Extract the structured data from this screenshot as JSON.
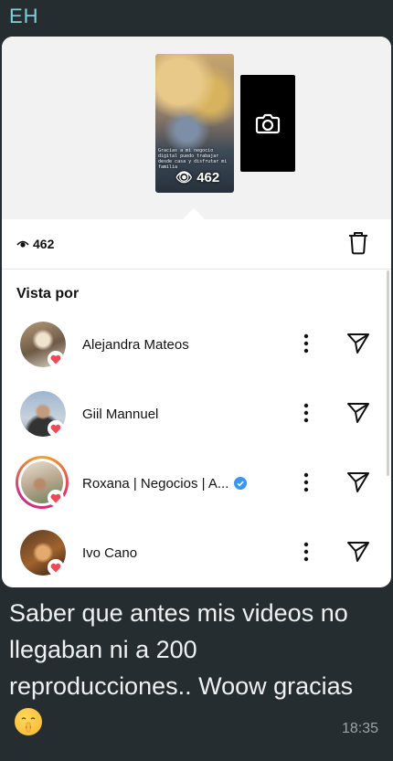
{
  "chat": {
    "sender_initials": "EH",
    "caption": "Saber que antes mis videos no llegaban ni a 200 reproducciones.. Woow gracias",
    "caption_emoji": "shushing-face-emoji",
    "timestamp": "18:35"
  },
  "story": {
    "thumbnail_overlay_text": "Gracias a mi negocio digital puedo trabajar desde casa y disfrutar mi familia",
    "thumbnail_view_count": "462",
    "camera_icon": "camera-icon"
  },
  "stats": {
    "views_icon": "eye-icon",
    "views": "462",
    "delete_icon": "trash-icon"
  },
  "viewers_section": {
    "title": "Vista por",
    "viewers": [
      {
        "name": "Alejandra Mateos",
        "liked": true,
        "verified": false,
        "story_ring": false
      },
      {
        "name": "Giil Mannuel",
        "liked": true,
        "verified": false,
        "story_ring": false
      },
      {
        "name": "Roxana | Negocios | A...",
        "liked": true,
        "verified": true,
        "story_ring": true
      },
      {
        "name": "Ivo Cano",
        "liked": true,
        "verified": false,
        "story_ring": false
      }
    ]
  },
  "colors": {
    "chat_bg": "#262d31",
    "initials": "#7fd1d9",
    "heart": "#ed4956",
    "verified": "#3897f0"
  }
}
